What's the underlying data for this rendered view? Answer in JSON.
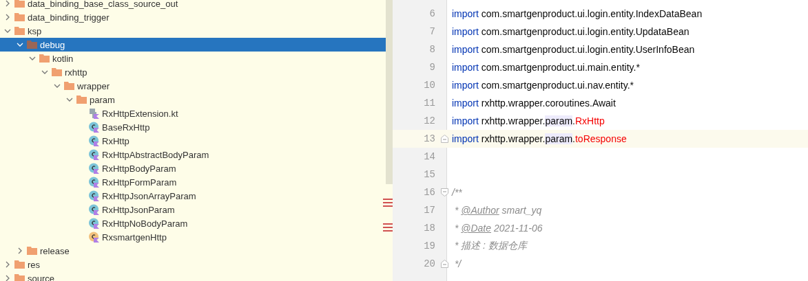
{
  "project_tree": {
    "items": [
      {
        "label": "data_binding_base_class_source_out",
        "kind": "folder",
        "expanded": false,
        "selected": false
      },
      {
        "label": "data_binding_trigger",
        "kind": "folder",
        "expanded": false,
        "selected": false
      },
      {
        "label": "ksp",
        "kind": "folder",
        "expanded": true,
        "selected": false,
        "children": [
          {
            "label": "debug",
            "kind": "folder",
            "expanded": true,
            "selected": true,
            "children": [
              {
                "label": "kotlin",
                "kind": "folder",
                "expanded": true,
                "selected": false,
                "children": [
                  {
                    "label": "rxhttp",
                    "kind": "folder",
                    "expanded": true,
                    "selected": false,
                    "children": [
                      {
                        "label": "wrapper",
                        "kind": "folder",
                        "expanded": true,
                        "selected": false,
                        "children": [
                          {
                            "label": "param",
                            "kind": "folder",
                            "expanded": true,
                            "selected": false,
                            "children": [
                              {
                                "label": "RxHttpExtension.kt",
                                "kind": "file",
                                "selected": false
                              },
                              {
                                "label": "BaseRxHttp",
                                "kind": "class",
                                "color": "#7cc4d8",
                                "selected": false
                              },
                              {
                                "label": "RxHttp",
                                "kind": "class",
                                "color": "#7cc4d8",
                                "selected": false
                              },
                              {
                                "label": "RxHttpAbstractBodyParam",
                                "kind": "class",
                                "color": "#7cc4d8",
                                "selected": false
                              },
                              {
                                "label": "RxHttpBodyParam",
                                "kind": "class",
                                "color": "#7cc4d8",
                                "selected": false
                              },
                              {
                                "label": "RxHttpFormParam",
                                "kind": "class",
                                "color": "#7cc4d8",
                                "selected": false
                              },
                              {
                                "label": "RxHttpJsonArrayParam",
                                "kind": "class",
                                "color": "#7cc4d8",
                                "selected": false
                              },
                              {
                                "label": "RxHttpJsonParam",
                                "kind": "class",
                                "color": "#7cc4d8",
                                "selected": false
                              },
                              {
                                "label": "RxHttpNoBodyParam",
                                "kind": "class",
                                "color": "#7cc4d8",
                                "selected": false
                              },
                              {
                                "label": "RxsmartgenHttp",
                                "kind": "class",
                                "color": "#f2c27e",
                                "selected": false
                              }
                            ]
                          }
                        ]
                      }
                    ]
                  }
                ]
              }
            ]
          },
          {
            "label": "release",
            "kind": "folder",
            "expanded": false,
            "selected": false
          }
        ]
      },
      {
        "label": "res",
        "kind": "folder",
        "expanded": false,
        "selected": false
      },
      {
        "label": "source",
        "kind": "folder",
        "expanded": false,
        "selected": false
      }
    ]
  },
  "editor": {
    "lines": [
      {
        "number": "6",
        "segments": [
          {
            "text": "import",
            "kind": "keyword"
          },
          {
            "text": " com.smartgenproduct.ui.login.entity.IndexDataBean",
            "kind": "plain"
          }
        ]
      },
      {
        "number": "7",
        "segments": [
          {
            "text": "import",
            "kind": "keyword"
          },
          {
            "text": " com.smartgenproduct.ui.login.entity.UpdataBean",
            "kind": "plain"
          }
        ]
      },
      {
        "number": "8",
        "segments": [
          {
            "text": "import",
            "kind": "keyword"
          },
          {
            "text": " com.smartgenproduct.ui.login.entity.UserInfoBean",
            "kind": "plain"
          }
        ]
      },
      {
        "number": "9",
        "segments": [
          {
            "text": "import",
            "kind": "keyword"
          },
          {
            "text": " com.smartgenproduct.ui.main.entity.*",
            "kind": "plain"
          }
        ]
      },
      {
        "number": "10",
        "segments": [
          {
            "text": "import",
            "kind": "keyword"
          },
          {
            "text": " com.smartgenproduct.ui.nav.entity.*",
            "kind": "plain"
          }
        ]
      },
      {
        "number": "11",
        "segments": [
          {
            "text": "import",
            "kind": "keyword"
          },
          {
            "text": " rxhttp.wrapper.coroutines.Await",
            "kind": "plain"
          }
        ]
      },
      {
        "number": "12",
        "segments": [
          {
            "text": "import",
            "kind": "keyword"
          },
          {
            "text": " rxhttp.wrapper.",
            "kind": "plain"
          },
          {
            "text": "param",
            "kind": "highlight"
          },
          {
            "text": ".",
            "kind": "plain"
          },
          {
            "text": "RxHttp",
            "kind": "error"
          }
        ]
      },
      {
        "number": "13",
        "current": true,
        "fold_end": true,
        "segments": [
          {
            "text": "import",
            "kind": "keyword"
          },
          {
            "text": " rxhttp.wrapper.",
            "kind": "plain"
          },
          {
            "text": "param",
            "kind": "highlight"
          },
          {
            "text": ".",
            "kind": "plain"
          },
          {
            "text": "toResponse",
            "kind": "error"
          }
        ]
      },
      {
        "number": "14"
      },
      {
        "number": "15"
      },
      {
        "number": "16",
        "fold_start": true,
        "segments": [
          {
            "text": "/**",
            "kind": "comment"
          }
        ]
      },
      {
        "number": "17",
        "segments": [
          {
            "text": " * ",
            "kind": "comment"
          },
          {
            "text": "@Author",
            "kind": "doctag"
          },
          {
            "text": " smart_yq",
            "kind": "comment"
          }
        ]
      },
      {
        "number": "18",
        "segments": [
          {
            "text": " * ",
            "kind": "comment"
          },
          {
            "text": "@Date",
            "kind": "doctag"
          },
          {
            "text": " 2021-11-06",
            "kind": "comment"
          }
        ]
      },
      {
        "number": "19",
        "segments": [
          {
            "text": " * 描述 : 数据仓库",
            "kind": "comment"
          }
        ]
      },
      {
        "number": "20",
        "fold_end": true,
        "segments": [
          {
            "text": " */",
            "kind": "comment"
          }
        ]
      }
    ]
  }
}
